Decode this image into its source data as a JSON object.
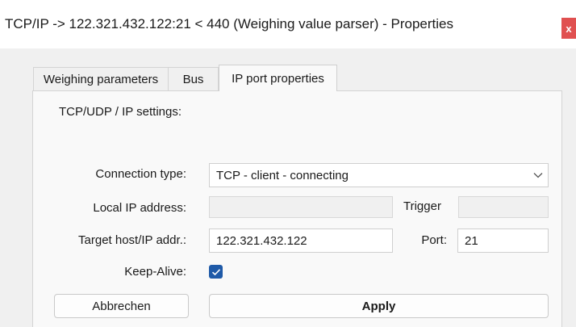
{
  "window": {
    "title": "TCP/IP -> 122.321.432.122:21 < 440 (Weighing value parser) - Properties",
    "close_glyph": "x"
  },
  "tabs": [
    {
      "label": "Weighing parameters",
      "active": false
    },
    {
      "label": "Bus",
      "active": false
    },
    {
      "label": "IP port properties",
      "active": true
    }
  ],
  "panel": {
    "section_title": "TCP/UDP / IP settings:",
    "connection_type": {
      "label": "Connection type:",
      "value": "TCP - client - connecting",
      "icon": "chevron-down-icon"
    },
    "local_ip": {
      "label": "Local IP address:",
      "value": ""
    },
    "trigger": {
      "label": "Trigger",
      "value": ""
    },
    "target_host": {
      "label": "Target host/IP addr.:",
      "value": "122.321.432.122"
    },
    "port": {
      "label": "Port:",
      "value": "21"
    },
    "keep_alive": {
      "label": "Keep-Alive:",
      "checked": true,
      "icon": "checkmark-icon"
    }
  },
  "buttons": {
    "cancel": "Abbrechen",
    "apply": "Apply"
  },
  "colors": {
    "accent": "#1f5aa8",
    "close": "#e05050"
  }
}
